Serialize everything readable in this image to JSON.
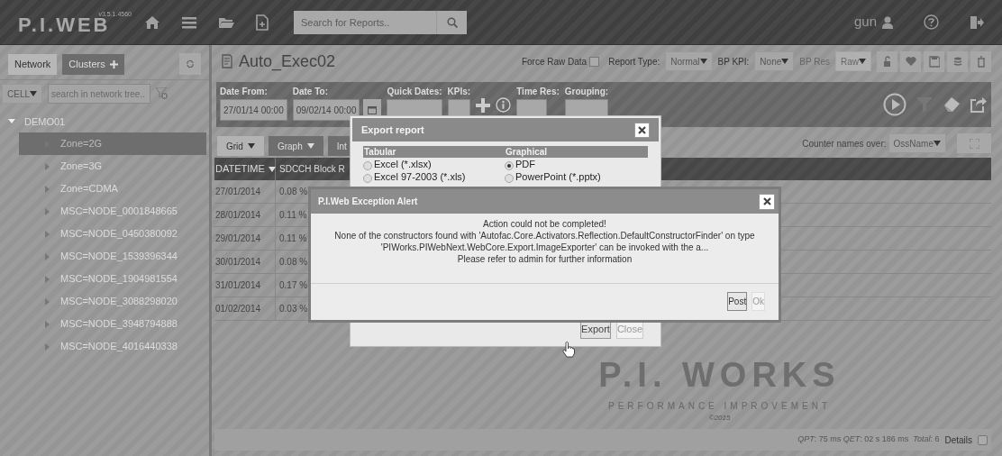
{
  "header": {
    "logo": "P.I.WEB",
    "version": "v3.5.1.4560",
    "search": {
      "placeholder": "Search for Reports.."
    },
    "user": "gun"
  },
  "sidebar": {
    "tabs": [
      {
        "label": "Network",
        "selected": true
      },
      {
        "label": "Clusters",
        "selected": false
      }
    ],
    "level_select": "CELL",
    "tree_search": {
      "placeholder": "search in network tree.."
    },
    "tree": [
      {
        "label": "DEMO01",
        "expanded": true,
        "selected": false,
        "children": [
          {
            "label": "Zone=2G",
            "expanded": false,
            "selected": true
          },
          {
            "label": "Zone=3G",
            "expanded": false,
            "selected": false
          },
          {
            "label": "Zone=CDMA",
            "expanded": false,
            "selected": false
          },
          {
            "label": "MSC=NODE_0001848665",
            "expanded": false,
            "selected": false
          },
          {
            "label": "MSC=NODE_0450380092",
            "expanded": false,
            "selected": false
          },
          {
            "label": "MSC=NODE_1539396344",
            "expanded": false,
            "selected": false
          },
          {
            "label": "MSC=NODE_1904981554",
            "expanded": false,
            "selected": false
          },
          {
            "label": "MSC=NODE_3088298020",
            "expanded": false,
            "selected": false
          },
          {
            "label": "MSC=NODE_3948794888",
            "expanded": false,
            "selected": false
          },
          {
            "label": "MSC=NODE_4016440338",
            "expanded": false,
            "selected": false
          }
        ]
      }
    ]
  },
  "report": {
    "title": "Auto_Exec02",
    "force_raw": {
      "label": "Force Raw Data",
      "checked": false
    },
    "report_type": {
      "label": "Report Type:",
      "value": "Normal"
    },
    "bp_kpi": {
      "label": "BP KPI:",
      "value": "None"
    },
    "bp_res": {
      "label": "BP Res",
      "value": "Raw",
      "disabled": true
    }
  },
  "params": {
    "labels": [
      "Date From:",
      "Date To:",
      "Quick Dates:",
      "KPIs:",
      "Time Res:",
      "Grouping:"
    ],
    "date_from": "27/01/14 00:00",
    "date_to": "09/02/14 00:00"
  },
  "view_tabs": [
    {
      "label": "Grid",
      "selected": true
    },
    {
      "label": "Graph",
      "selected": false
    },
    {
      "label": "Int",
      "selected": false
    }
  ],
  "counter_names": {
    "label": "Counter names over:",
    "value": "OssName"
  },
  "table": {
    "columns": [
      "DATETIME",
      "SDCCH Block R"
    ],
    "rows": [
      [
        "27/01/2014",
        "0.08 %"
      ],
      [
        "28/01/2014",
        "0.11 %"
      ],
      [
        "29/01/2014",
        "0.11 %"
      ],
      [
        "30/01/2014",
        "0.08 %"
      ],
      [
        "31/01/2014",
        "0.17 %"
      ],
      [
        "01/02/2014",
        "0.03 %"
      ]
    ]
  },
  "brand": {
    "name": "P.I. WORKS",
    "tagline": "PERFORMANCE IMPROVEMENT",
    "copyright": "©2015"
  },
  "footer": {
    "stats": "*QPT*: 75 ms *QET*: 02 s 186 ms  *Total*: 6",
    "details": {
      "label": "Details",
      "checked": false
    }
  },
  "export_dialog": {
    "title": "Export report",
    "columns": [
      "Tabular",
      "Graphical"
    ],
    "tabular": [
      {
        "label": "Excel (*.xlsx)",
        "selected": false
      },
      {
        "label": "Excel 97-2003 (*.xls)",
        "selected": false
      }
    ],
    "graphical": [
      {
        "label": "PDF",
        "selected": true
      },
      {
        "label": "PowerPoint (*.pptx)",
        "selected": false
      }
    ],
    "buttons": [
      "Export",
      "Close"
    ]
  },
  "alert": {
    "title": "P.I.Web Exception Alert",
    "lines": [
      "Action could not be completed!",
      "None of the constructors found with 'Autofac.Core.Activators.Reflection.DefaultConstructorFinder' on type 'PIWorks.PIWebNext.WebCore.Export.ImageExporter' can be invoked with the a...",
      "Please refer to admin for further information"
    ],
    "buttons": [
      {
        "label": "Post",
        "disabled": false
      },
      {
        "label": "Ok",
        "disabled": true
      }
    ]
  }
}
